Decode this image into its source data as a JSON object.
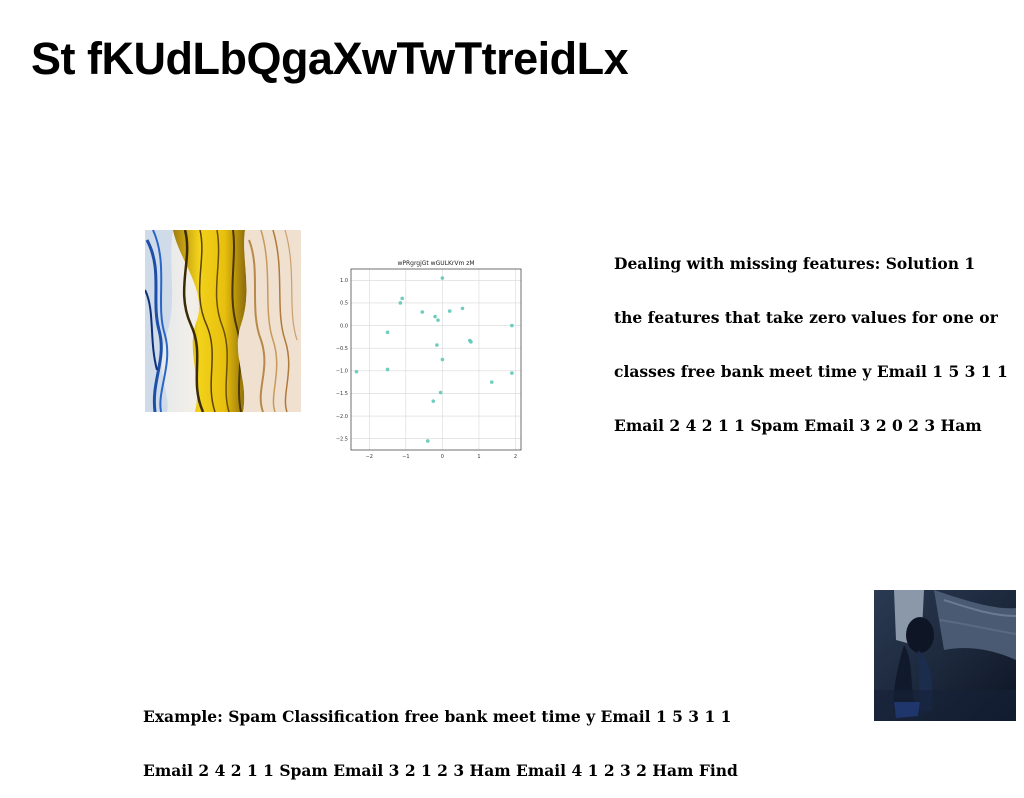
{
  "slide": {
    "title": "St fKUdLbQgaXwTwTtreidLx",
    "side_text_lines": [
      "Dealing with missing features: Solution 1",
      "the features that take zero values for one or",
      "classes free bank meet time y Email 1 5 3 1 1",
      "Email 2 4 2 1 1 Spam Email 3 2 0 2 3 Ham"
    ],
    "bottom_text_lines": [
      "Example: Spam Classification free bank meet time y Email 1 5 3 1 1",
      "Email 2 4 2 1 1 Spam Email 3 2 1 2 3 Ham Email 4 1 2 3 2 Ham Find"
    ]
  },
  "chart_data": {
    "type": "scatter",
    "title": "wPRgrgjGt wGULKrVm zM",
    "xlim": [
      -2.5,
      2.15
    ],
    "ylim": [
      -2.75,
      1.25
    ],
    "xticks": [
      -2,
      -1,
      0,
      1,
      2
    ],
    "xtick_labels": [
      "−2",
      "−1",
      "0",
      "1",
      "2"
    ],
    "yticks": [
      1.0,
      0.5,
      0.0,
      -0.5,
      -1.0,
      -1.5,
      -2.0,
      -2.5
    ],
    "ytick_labels": [
      "1.0",
      "0.5",
      "0.0",
      "−0.5",
      "−1.0",
      "−1.5",
      "−2.0",
      "−2.5"
    ],
    "grid": true,
    "color": "#5ec8b8",
    "points": [
      {
        "x": 0.0,
        "y": 1.05
      },
      {
        "x": -1.1,
        "y": 0.6
      },
      {
        "x": -1.15,
        "y": 0.5
      },
      {
        "x": -0.55,
        "y": 0.3
      },
      {
        "x": 0.2,
        "y": 0.32
      },
      {
        "x": 0.55,
        "y": 0.38
      },
      {
        "x": -0.2,
        "y": 0.2
      },
      {
        "x": -0.12,
        "y": 0.12
      },
      {
        "x": 1.9,
        "y": 0.0
      },
      {
        "x": -1.5,
        "y": -0.15
      },
      {
        "x": 0.75,
        "y": -0.33
      },
      {
        "x": 0.78,
        "y": -0.36
      },
      {
        "x": -0.15,
        "y": -0.43
      },
      {
        "x": 0.0,
        "y": -0.75
      },
      {
        "x": -2.35,
        "y": -1.02
      },
      {
        "x": -1.5,
        "y": -0.97
      },
      {
        "x": 1.9,
        "y": -1.05
      },
      {
        "x": 1.35,
        "y": -1.25
      },
      {
        "x": -0.05,
        "y": -1.48
      },
      {
        "x": -0.25,
        "y": -1.67
      },
      {
        "x": -0.4,
        "y": -2.55
      }
    ]
  }
}
